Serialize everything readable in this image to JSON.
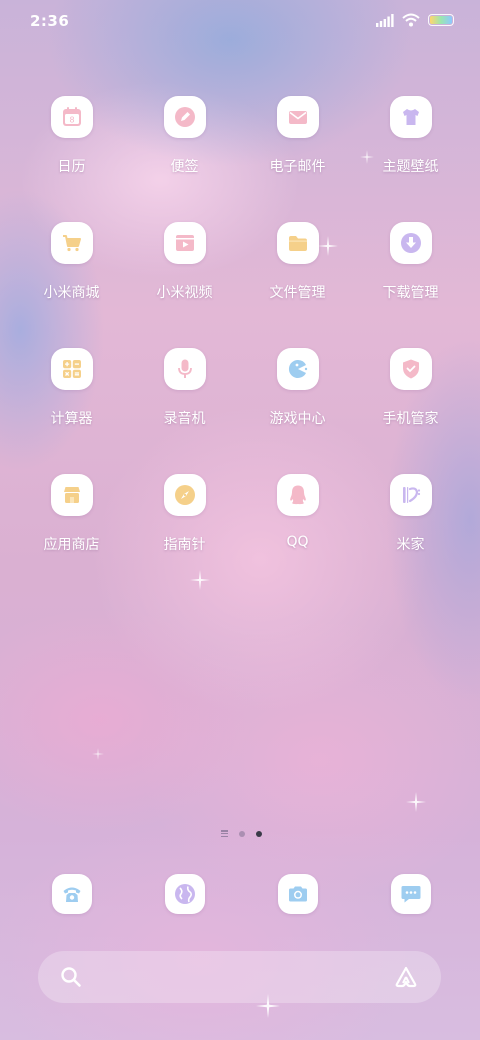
{
  "status_bar": {
    "time": "2:36",
    "icons": [
      "signal-icon",
      "wifi-icon",
      "battery-icon"
    ]
  },
  "apps": [
    {
      "label": "日历",
      "icon": "calendar-icon",
      "color": "#f4b9c8"
    },
    {
      "label": "便签",
      "icon": "notes-pencil-icon",
      "color": "#f4b9c8"
    },
    {
      "label": "电子邮件",
      "icon": "mail-icon",
      "color": "#f4b9c8"
    },
    {
      "label": "主题壁纸",
      "icon": "tshirt-icon",
      "color": "#c9b7ef"
    },
    {
      "label": "小米商城",
      "icon": "cart-icon",
      "color": "#f5d08a"
    },
    {
      "label": "小米视频",
      "icon": "video-icon",
      "color": "#f4b9c8"
    },
    {
      "label": "文件管理",
      "icon": "folder-icon",
      "color": "#f5d08a"
    },
    {
      "label": "下载管理",
      "icon": "download-icon",
      "color": "#c9b7ef"
    },
    {
      "label": "计算器",
      "icon": "calculator-icon",
      "color": "#f5d08a"
    },
    {
      "label": "录音机",
      "icon": "microphone-icon",
      "color": "#f4b9c8"
    },
    {
      "label": "游戏中心",
      "icon": "game-pacman-icon",
      "color": "#9ecdf0"
    },
    {
      "label": "手机管家",
      "icon": "shield-icon",
      "color": "#f4b9c8"
    },
    {
      "label": "应用商店",
      "icon": "store-icon",
      "color": "#f5d08a"
    },
    {
      "label": "指南针",
      "icon": "compass-icon",
      "color": "#f5d08a"
    },
    {
      "label": "QQ",
      "icon": "qq-penguin-icon",
      "color": "#f4b9c8"
    },
    {
      "label": "米家",
      "icon": "mijia-icon",
      "color": "#c9b7ef"
    }
  ],
  "page_indicator": {
    "pages": 2,
    "active_page": 2
  },
  "dock": [
    {
      "icon": "phone-icon",
      "color": "#9ecdf0"
    },
    {
      "icon": "browser-globe-icon",
      "color": "#c9b7ef"
    },
    {
      "icon": "camera-icon",
      "color": "#9ecdf0"
    },
    {
      "icon": "messages-icon",
      "color": "#9ecdf0"
    }
  ],
  "search_bar": {
    "left_icon": "search-icon",
    "right_icon": "assistant-icon"
  }
}
